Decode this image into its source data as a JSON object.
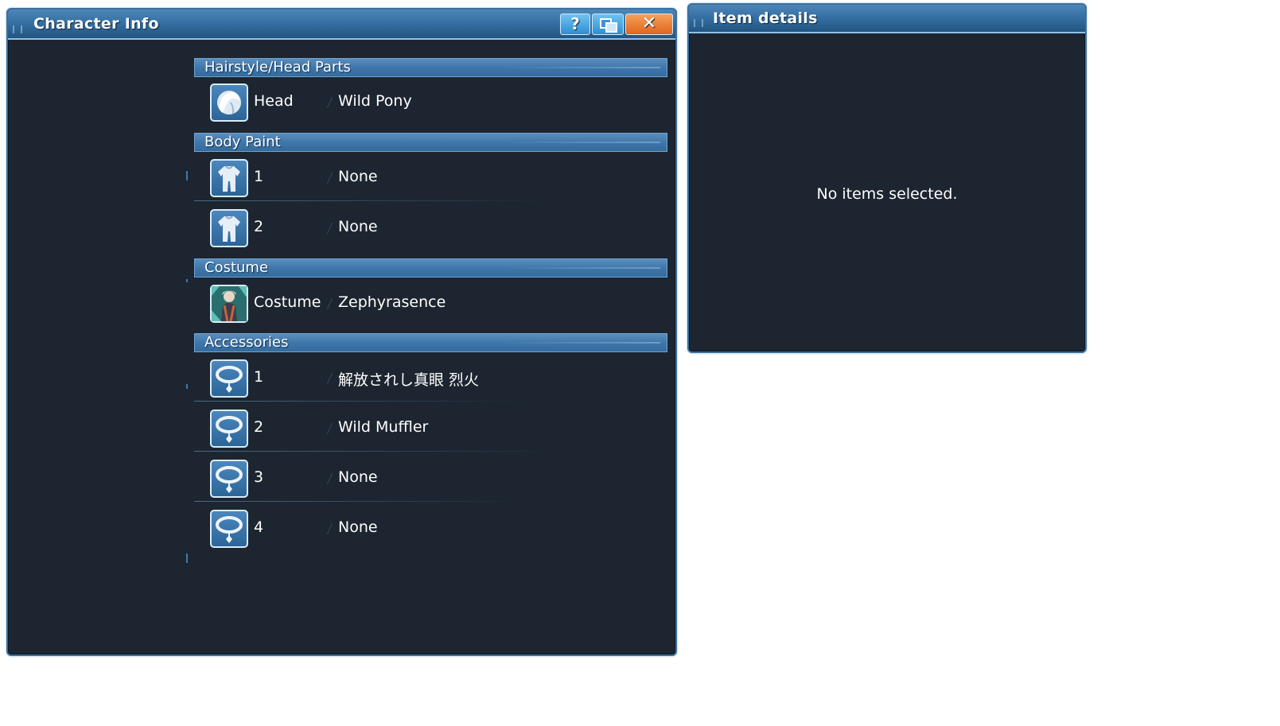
{
  "character_window": {
    "title": "Character Info",
    "help_label": "?",
    "close_label": "✕"
  },
  "sections": {
    "hair": {
      "title": "Hairstyle/Head Parts",
      "rows": [
        {
          "label": "Head",
          "value": "Wild Pony",
          "icon": "hair-icon"
        }
      ]
    },
    "body_paint": {
      "title": "Body Paint",
      "rows": [
        {
          "label": "1",
          "value": "None",
          "icon": "body-paint-icon"
        },
        {
          "label": "2",
          "value": "None",
          "icon": "body-paint-icon"
        }
      ]
    },
    "costume": {
      "title": "Costume",
      "rows": [
        {
          "label": "Costume",
          "value": "Zephyrasence",
          "icon": "costume-portrait-icon"
        }
      ]
    },
    "accessories": {
      "title": "Accessories",
      "rows": [
        {
          "label": "1",
          "value": "解放されし真眼 烈火",
          "icon": "accessory-icon"
        },
        {
          "label": "2",
          "value": "Wild Muffler",
          "icon": "accessory-icon"
        },
        {
          "label": "3",
          "value": "None",
          "icon": "accessory-icon"
        },
        {
          "label": "4",
          "value": "None",
          "icon": "accessory-icon"
        }
      ]
    }
  },
  "item_window": {
    "title": "Item details",
    "empty_message": "No items selected."
  },
  "colors": {
    "window_bg": "#1c2530",
    "title_bar": "#3670a3",
    "section_header": "#3f77aa",
    "close_button": "#e0651c",
    "help_button": "#2f8fd1"
  }
}
